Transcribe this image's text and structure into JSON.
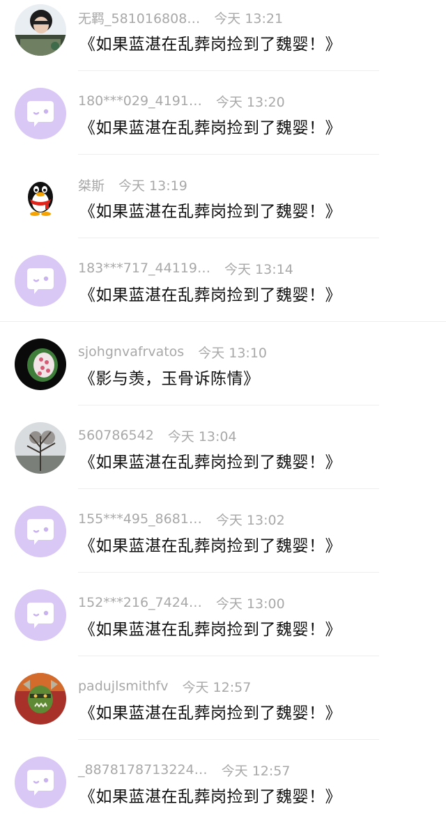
{
  "colors": {
    "placeholder_avatar_bg": "#d9c7f6",
    "meta_text": "#a8a8a8",
    "content_text": "#111111"
  },
  "comments": [
    {
      "name": "无羁_581016808…",
      "time": "今天 13:21",
      "content": "《如果蓝湛在乱葬岗捡到了魏婴！》",
      "avatar": "photo-person"
    },
    {
      "name": "180***029_4191…",
      "time": "今天 13:20",
      "content": "《如果蓝湛在乱葬岗捡到了魏婴！》",
      "avatar": "default-chat"
    },
    {
      "name": "桀斯",
      "time": "今天 13:19",
      "content": "《如果蓝湛在乱葬岗捡到了魏婴！》",
      "avatar": "qq-penguin"
    },
    {
      "name": "183***717_44119…",
      "time": "今天 13:14",
      "content": "《如果蓝湛在乱葬岗捡到了魏婴！》",
      "avatar": "default-chat"
    },
    {
      "name": "sjohgnvafrvatos",
      "time": "今天 13:10",
      "content": "《影与羡，玉骨诉陈情》",
      "avatar": "photo-carving"
    },
    {
      "name": "560786542",
      "time": "今天 13:04",
      "content": "《如果蓝湛在乱葬岗捡到了魏婴！》",
      "avatar": "photo-tree"
    },
    {
      "name": "155***495_8681…",
      "time": "今天 13:02",
      "content": "《如果蓝湛在乱葬岗捡到了魏婴！》",
      "avatar": "default-chat"
    },
    {
      "name": "152***216_7424…",
      "time": "今天 13:00",
      "content": "《如果蓝湛在乱葬岗捡到了魏婴！》",
      "avatar": "default-chat"
    },
    {
      "name": "padujlsmithfv",
      "time": "今天 12:57",
      "content": "《如果蓝湛在乱葬岗捡到了魏婴！》",
      "avatar": "photo-orc"
    },
    {
      "name": "_8878178713224…",
      "time": "今天 12:57",
      "content": "《如果蓝湛在乱葬岗捡到了魏婴！》",
      "avatar": "default-chat"
    }
  ]
}
